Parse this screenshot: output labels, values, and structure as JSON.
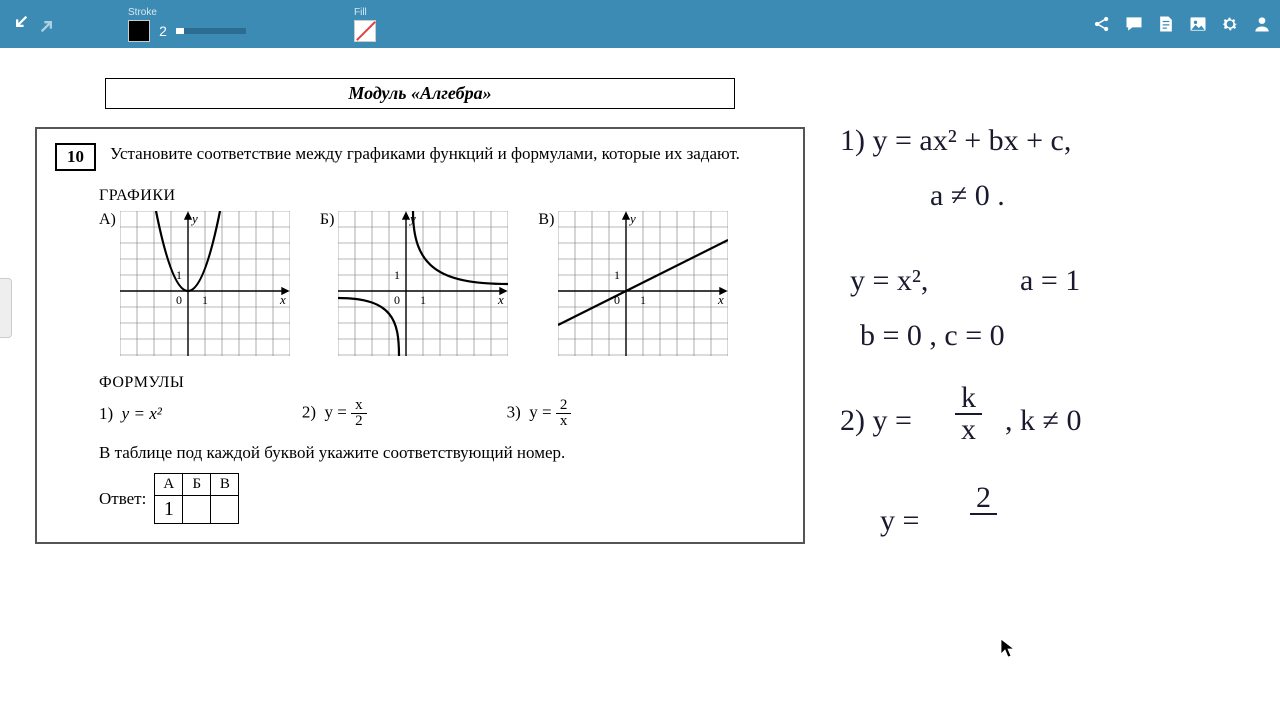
{
  "toolbar": {
    "stroke_label": "Stroke",
    "stroke_value": "2",
    "fill_label": "Fill"
  },
  "document": {
    "module_title": "Модуль «Алгебра»",
    "question_number": "10",
    "question_text": "Установите соответствие между графиками функций и формулами, которые их задают.",
    "graphs_heading": "ГРАФИКИ",
    "graph_labels": {
      "a": "А)",
      "b": "Б)",
      "c": "В)"
    },
    "formulas_heading": "ФОРМУЛЫ",
    "formula1_prefix": "1)  ",
    "formula1_body": "y = x²",
    "formula2_prefix": "2)  y = ",
    "formula2_top": "x",
    "formula2_bot": "2",
    "formula3_prefix": "3)  y = ",
    "formula3_top": "2",
    "formula3_bot": "x",
    "hint": "В таблице под каждой буквой укажите соответствующий номер.",
    "answer_label": "Ответ:",
    "answer_headers": {
      "a": "А",
      "b": "Б",
      "c": "В"
    },
    "answer_values": {
      "a": "1",
      "b": "",
      "c": ""
    },
    "axis": {
      "y": "y",
      "x": "x",
      "zero": "0",
      "one_x": "1",
      "one_y": "1"
    }
  },
  "handwriting": {
    "l1": "1) y = ax² + bx + c,",
    "l2": "a ≠ 0 .",
    "l3a": "y = x²,",
    "l3b": "a = 1",
    "l4": "b = 0 ,  c = 0",
    "l5a": "2) y = ",
    "l5b": "k",
    "l5c": "x",
    "l5d": ",   k ≠ 0",
    "l6a": "y = ",
    "l6b": "2"
  }
}
